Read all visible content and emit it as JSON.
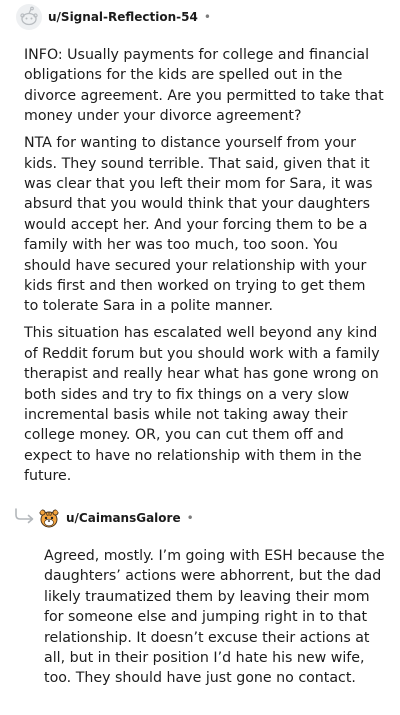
{
  "parent_comment": {
    "username": "u/Signal-Reflection-54",
    "separator": "•",
    "paragraphs": [
      "INFO: Usually payments for college and financial obligations for the kids are spelled out in the divorce agreement. Are you permitted to take that money under your divorce agreement?",
      "NTA for wanting to distance yourself from your kids. They sound terrible. That said, given that it was clear that you left their mom for Sara, it was absurd that you would think that your daughters would accept her. And your forcing them to be a family with her was too much, too soon. You should have secured your relationship with your kids first and then worked on trying to get them to tolerate Sara in a polite manner.",
      "This situation has escalated well beyond any kind of Reddit forum but you should work with a family therapist and really hear what has gone wrong on both sides and try to fix things on a very slow incremental basis while not taking away their college money. OR, you can cut them off and expect to have no relationship with them in the future."
    ]
  },
  "reply_comment": {
    "username": "u/CaimansGalore",
    "separator": "•",
    "paragraphs": [
      "Agreed, mostly. I’m going with ESH because the daughters’ actions were abhorrent, but the dad likely traumatized them by leaving their mom for someone else and jumping right in to that relationship. It doesn’t excuse their actions at all, but in their position I’d hate his new wife, too. They should have just gone no contact."
    ]
  },
  "icons": {
    "parent_avatar": "default-snoo-avatar-icon",
    "reply_avatar": "tiger-avatar-icon",
    "reply_indicator": "reply-arrow-icon"
  },
  "colors": {
    "text": "#1c1c1c",
    "meta": "#7c7c7c",
    "avatar_bg": "#f1f2f3"
  }
}
